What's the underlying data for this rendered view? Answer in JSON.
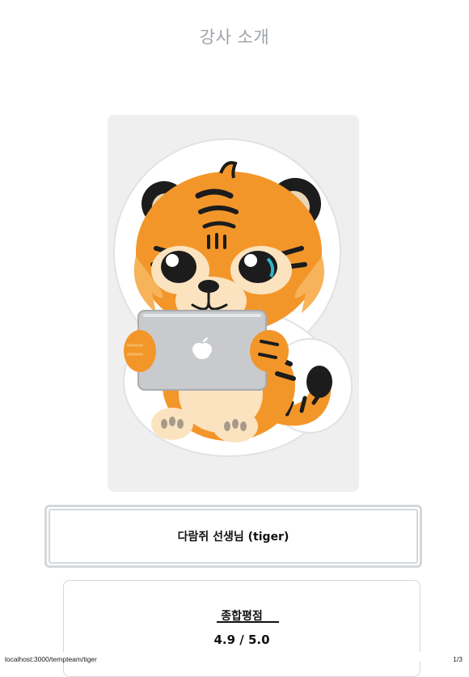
{
  "header": {
    "title": "강사 소개"
  },
  "portrait": {
    "description_icon": "tiger-with-laptop-illustration",
    "laptop_logo": "apple-logo-icon",
    "colors": {
      "card_bg": "#efefef",
      "tiger_orange": "#f3962a",
      "tiger_light": "#fbc46a",
      "stripe": "#1c1c1c",
      "laptop": "#c9cacd"
    }
  },
  "teacher": {
    "name": "다람쥐 선생님 (tiger)"
  },
  "rating": {
    "label": "종합평점",
    "value": "4.9 / 5.0"
  },
  "footer": {
    "url": "localhost:3000/tempteam/tiger",
    "page": "1/3"
  }
}
